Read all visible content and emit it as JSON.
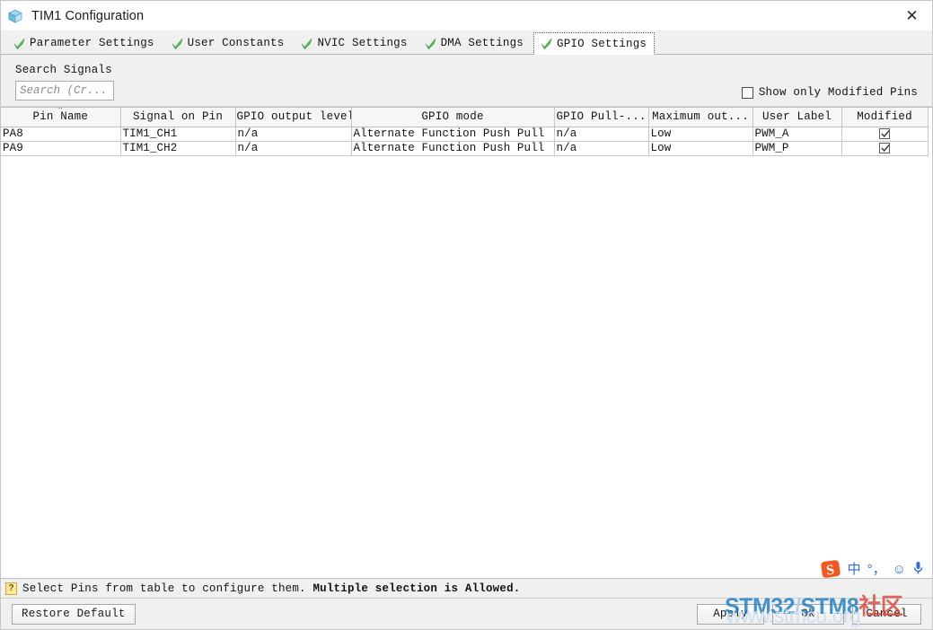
{
  "window": {
    "title": "TIM1 Configuration",
    "icon": "cube-icon",
    "close_label": "✕"
  },
  "tabs": [
    {
      "label": "Parameter Settings",
      "icon": "green-check-icon",
      "selected": false
    },
    {
      "label": "User Constants",
      "icon": "green-check-icon",
      "selected": false
    },
    {
      "label": "NVIC Settings",
      "icon": "green-check-icon",
      "selected": false
    },
    {
      "label": "DMA Settings",
      "icon": "green-check-icon",
      "selected": false
    },
    {
      "label": "GPIO Settings",
      "icon": "green-check-icon",
      "selected": true
    }
  ],
  "search": {
    "label": "Search Signals",
    "placeholder": "Search (Cr...",
    "value": ""
  },
  "show_modified": {
    "label": "Show only Modified Pins",
    "checked": false
  },
  "table": {
    "sorted_column": "Pin Name",
    "sort_caret": "⌃",
    "columns": [
      "Pin Name",
      "Signal on Pin",
      "GPIO output level",
      "GPIO mode",
      "GPIO Pull-...",
      "Maximum out...",
      "User Label",
      "Modified"
    ],
    "rows": [
      {
        "pin_name": "PA8",
        "signal_on_pin": "TIM1_CH1",
        "gpio_output_level": "n/a",
        "gpio_mode": "Alternate Function Push Pull",
        "gpio_pull": "n/a",
        "maximum_output": "Low",
        "user_label": "PWM_A",
        "modified": true
      },
      {
        "pin_name": "PA9",
        "signal_on_pin": "TIM1_CH2",
        "gpio_output_level": "n/a",
        "gpio_mode": "Alternate Function Push Pull",
        "gpio_pull": "n/a",
        "maximum_output": "Low",
        "user_label": "PWM_P",
        "modified": true
      }
    ]
  },
  "status": {
    "icon": "help-question-icon",
    "text_normal": "Select Pins from table to configure them. ",
    "text_bold": "Multiple selection is Allowed."
  },
  "buttons": {
    "restore_default": "Restore Default",
    "apply": "Apply",
    "ok": "Ok",
    "cancel": "Cancel"
  },
  "watermark": {
    "part1": "STM32",
    "part2": "/",
    "part3": "STM8",
    "part4": "社区",
    "url": "www.stmcu.org"
  },
  "ime": {
    "logo": "sogou-logo-icon",
    "mode": "中",
    "punctuation": "°，",
    "emoji": "☺",
    "mic": "🎙"
  },
  "colors": {
    "accent_blue": "#1f7ec4",
    "check_green": "#55c455",
    "watermark_light": "#cfe0ec",
    "ime_orange": "#f5551f"
  }
}
